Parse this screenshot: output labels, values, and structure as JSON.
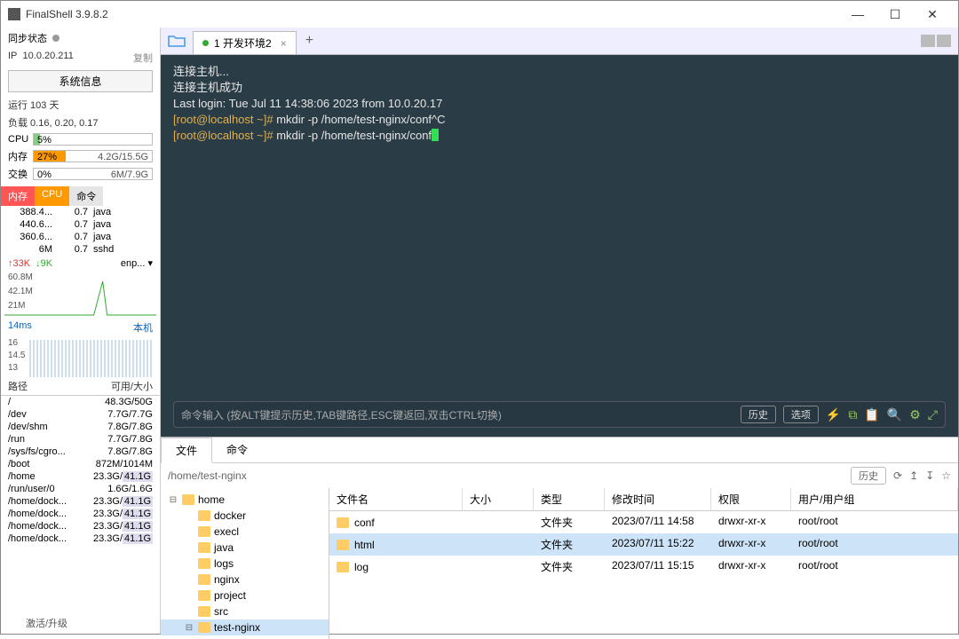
{
  "title": "FinalShell 3.9.8.2",
  "sync_label": "同步状态",
  "ip_label": "IP",
  "ip_value": "10.0.20.211",
  "copy_label": "复制",
  "sysinfo_btn": "系统信息",
  "uptime": "运行 103 天",
  "load": "负载 0.16, 0.20, 0.17",
  "cpu": {
    "label": "CPU",
    "pct": "5%",
    "width": "5%"
  },
  "mem": {
    "label": "内存",
    "pct": "27%",
    "width": "27%",
    "rhs": "4.2G/15.5G"
  },
  "swap": {
    "label": "交换",
    "pct": "0%",
    "width": "0%",
    "rhs": "6M/7.9G"
  },
  "tabs3": {
    "mem": "内存",
    "cpu": "CPU",
    "cmd": "命令"
  },
  "procs": [
    {
      "mem": "388.4...",
      "cpu": "0.7",
      "cmd": "java"
    },
    {
      "mem": "440.6...",
      "cpu": "0.7",
      "cmd": "java"
    },
    {
      "mem": "360.6...",
      "cpu": "0.7",
      "cmd": "java"
    },
    {
      "mem": "6M",
      "cpu": "0.7",
      "cmd": "sshd"
    }
  ],
  "net": {
    "up": "↑33K",
    "down": "↓9K",
    "iface": "enp... ▾"
  },
  "net_y": [
    "60.8M",
    "42.1M",
    "21M"
  ],
  "ping": {
    "val": "14ms",
    "host": "本机"
  },
  "ping_y": [
    "16",
    "14.5",
    "13"
  ],
  "disk_hdr": {
    "path": "路径",
    "size": "可用/大小"
  },
  "disks": [
    {
      "p": "/",
      "s": "48.3G/50G",
      "hl": false
    },
    {
      "p": "/dev",
      "s": "7.7G/7.7G",
      "hl": false
    },
    {
      "p": "/dev/shm",
      "s": "7.8G/7.8G",
      "hl": false
    },
    {
      "p": "/run",
      "s": "7.7G/7.8G",
      "hl": false
    },
    {
      "p": "/sys/fs/cgro...",
      "s": "7.8G/7.8G",
      "hl": false
    },
    {
      "p": "/boot",
      "s": "872M/1014M",
      "hl": false
    },
    {
      "p": "/home",
      "s": "23.3G/41.1G",
      "hl": true
    },
    {
      "p": "/run/user/0",
      "s": "1.6G/1.6G",
      "hl": false
    },
    {
      "p": "/home/dock...",
      "s": "23.3G/41.1G",
      "hl": true
    },
    {
      "p": "/home/dock...",
      "s": "23.3G/41.1G",
      "hl": true
    },
    {
      "p": "/home/dock...",
      "s": "23.3G/41.1G",
      "hl": true
    },
    {
      "p": "/home/dock...",
      "s": "23.3G/41.1G",
      "hl": true
    }
  ],
  "footer": "激活/升级",
  "tab_label": "1 开发环境2",
  "term_lines": [
    "连接主机...",
    "连接主机成功",
    "Last login: Tue Jul 11 14:38:06 2023 from 10.0.20.17"
  ],
  "term_prompt": "[root@localhost ~]# ",
  "term_cmd1": "mkdir -p /home/test-nginx/conf^C",
  "term_cmd2": "mkdir -p /home/test-nginx/conf",
  "cmdbar_placeholder": "命令输入 (按ALT键提示历史,TAB键路径,ESC键返回,双击CTRL切换)",
  "cmdbar_history": "历史",
  "cmdbar_options": "选项",
  "lowtabs": {
    "file": "文件",
    "cmd": "命令"
  },
  "path": "/home/test-nginx",
  "path_history": "历史",
  "tree": [
    {
      "indent": 0,
      "label": "home",
      "exp": "⊟",
      "sel": false
    },
    {
      "indent": 1,
      "label": "docker",
      "exp": "",
      "sel": false
    },
    {
      "indent": 1,
      "label": "execl",
      "exp": "",
      "sel": false
    },
    {
      "indent": 1,
      "label": "java",
      "exp": "",
      "sel": false
    },
    {
      "indent": 1,
      "label": "logs",
      "exp": "",
      "sel": false
    },
    {
      "indent": 1,
      "label": "nginx",
      "exp": "",
      "sel": false
    },
    {
      "indent": 1,
      "label": "project",
      "exp": "",
      "sel": false
    },
    {
      "indent": 1,
      "label": "src",
      "exp": "",
      "sel": false
    },
    {
      "indent": 1,
      "label": "test-nginx",
      "exp": "⊟",
      "sel": true
    }
  ],
  "filehdr": {
    "name": "文件名",
    "size": "大小",
    "type": "类型",
    "mod": "修改时间",
    "perm": "权限",
    "own": "用户/用户组"
  },
  "files": [
    {
      "name": "conf",
      "size": "",
      "type": "文件夹",
      "mod": "2023/07/11 14:58",
      "perm": "drwxr-xr-x",
      "own": "root/root",
      "sel": false
    },
    {
      "name": "html",
      "size": "",
      "type": "文件夹",
      "mod": "2023/07/11 15:22",
      "perm": "drwxr-xr-x",
      "own": "root/root",
      "sel": true
    },
    {
      "name": "log",
      "size": "",
      "type": "文件夹",
      "mod": "2023/07/11 15:15",
      "perm": "drwxr-xr-x",
      "own": "root/root",
      "sel": false
    }
  ]
}
